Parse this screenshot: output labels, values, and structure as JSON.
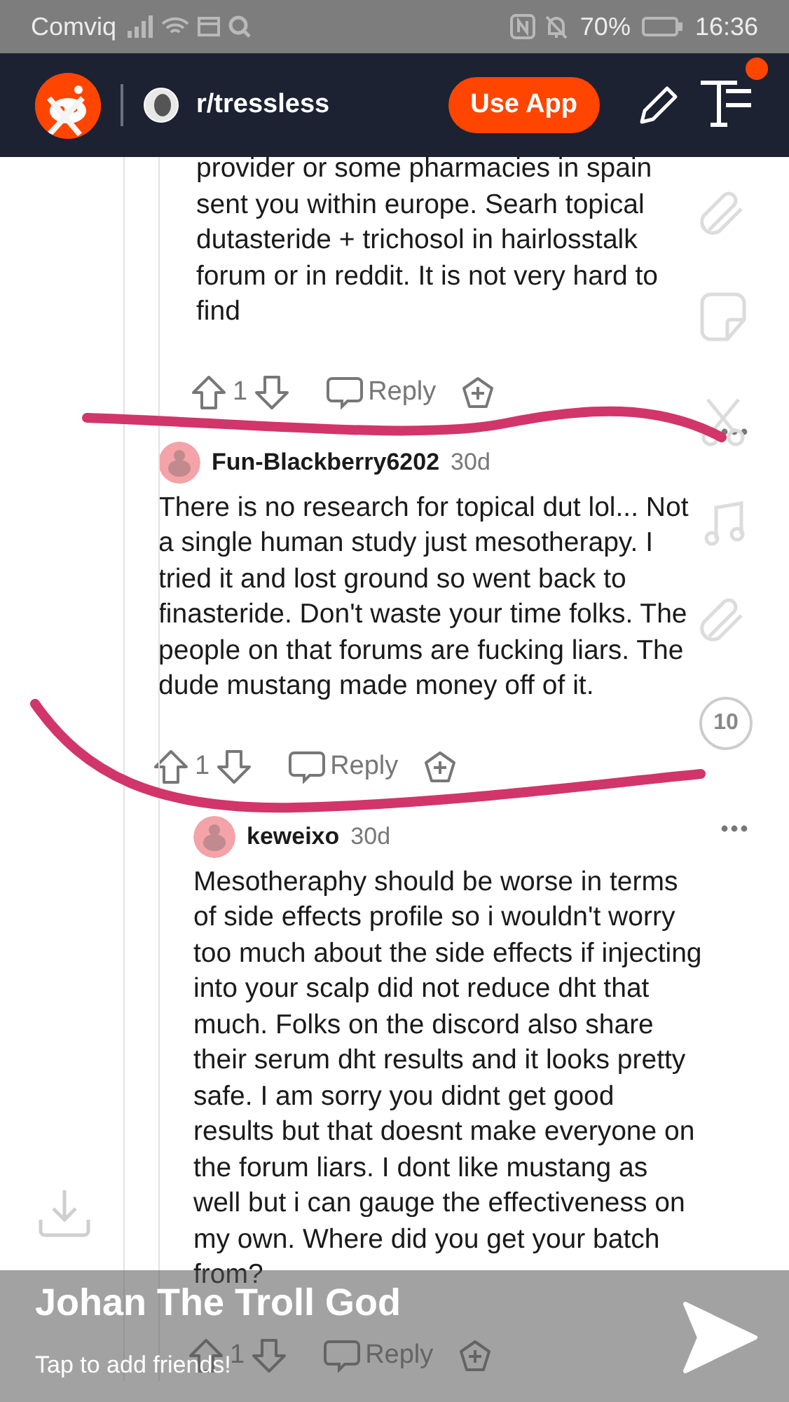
{
  "status_bar": {
    "carrier": "Comviq",
    "battery": "70%",
    "time": "16:36"
  },
  "header": {
    "subreddit": "r/tressless",
    "button": "Use App",
    "notification_dot": true
  },
  "earlier_reply": {
    "body": "provider or some pharmacies in spain sent you within europe. Searh topical dutasteride + trichosol in hairlosstalk forum or in reddit. It is not very hard to find",
    "votes": "1",
    "reply": "Reply"
  },
  "comments": [
    {
      "author": "Fun-Blackberry6202",
      "age": "30d",
      "body": "There is no research for topical dut lol... Not a single human study just mesotherapy. I tried it and lost ground so went back to finasteride. Don't waste your time folks. The people on that forums are fucking liars. The dude mustang made money off of it.",
      "votes": "1",
      "reply": "Reply",
      "children": [
        {
          "author": "keweixo",
          "age": "30d",
          "body": "Mesotheraphy should be worse in terms of side effects profile so i wouldn't worry too much about the side effects if injecting into your scalp did not reduce dht that much. Folks on the discord also share their serum dht results and it looks pretty safe. I am sorry you didnt get good results but that doesnt make everyone on the forum liars. I dont like mustang as well but i can gauge the effectiveness on my own. Where did you get your batch from?",
          "votes": "1",
          "reply": "Reply"
        }
      ]
    }
  ],
  "snap_overlay": {
    "name": "Johan The Troll God",
    "subtitle": "Tap to add friends!",
    "timer": "10"
  }
}
